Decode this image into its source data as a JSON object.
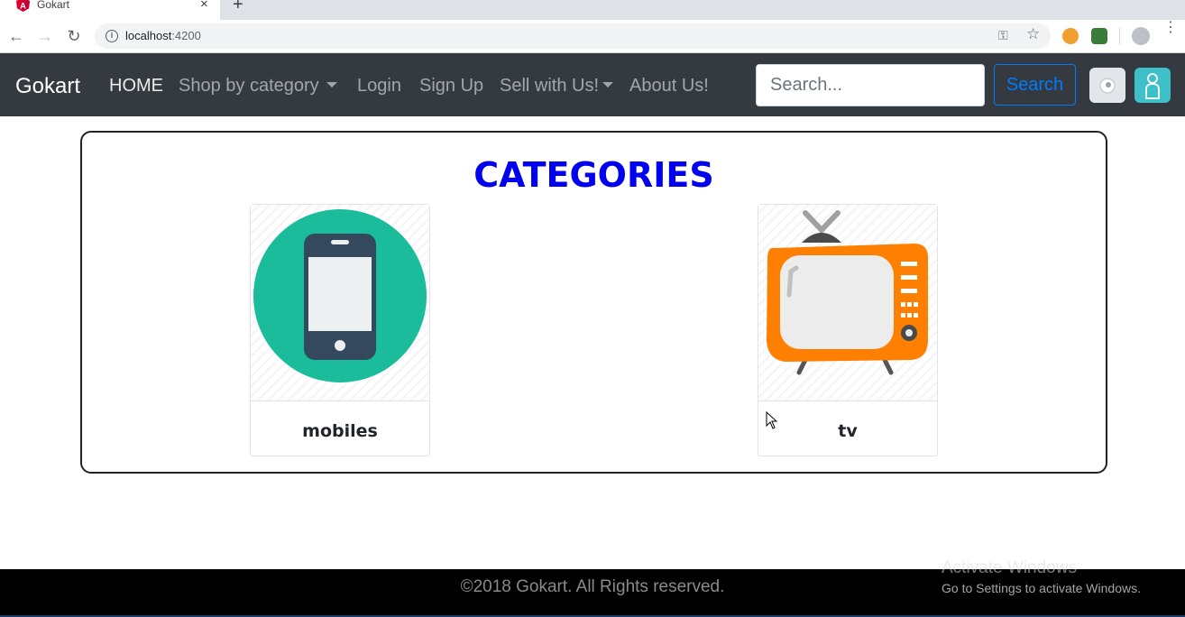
{
  "browser": {
    "tab_title": "Gokart",
    "tab_close": "×",
    "new_tab": "+",
    "url_host": "localhost",
    "url_port": ":4200"
  },
  "navbar": {
    "brand": "Gokart",
    "links": {
      "home": "HOME",
      "shop": "Shop by category",
      "login": "Login",
      "signup": "Sign Up",
      "sell": "Sell with Us!",
      "about": "About Us!"
    },
    "search_placeholder": "Search...",
    "search_button": "Search"
  },
  "main": {
    "heading": "CATEGORIES",
    "categories": [
      {
        "label": "mobiles",
        "icon": "mobile-phone-icon"
      },
      {
        "label": "tv",
        "icon": "television-icon"
      }
    ]
  },
  "footer": {
    "copyright": "©2018 Gokart. All Rights reserved.",
    "watermark_title": "Activate Windows",
    "watermark_sub": "Go to Settings to activate Windows."
  },
  "colors": {
    "navbar_bg": "#343a40",
    "heading": "#0000ee",
    "primary": "#007bff",
    "info": "#3fbfc8"
  }
}
